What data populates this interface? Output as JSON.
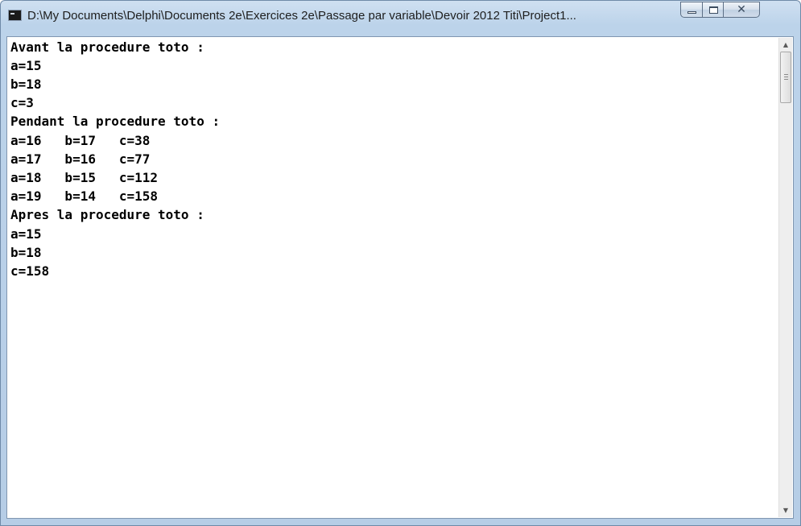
{
  "window": {
    "title": "D:\\My Documents\\Delphi\\Documents 2e\\Exercices 2e\\Passage par variable\\Devoir 2012 Titi\\Project1..."
  },
  "title_buttons": {
    "minimize_icon": "minimize-icon",
    "maximize_icon": "maximize-icon",
    "close_icon": "close-icon",
    "close_glyph": "✕"
  },
  "console": {
    "lines": [
      "Avant la procedure toto :",
      "a=15",
      "b=18",
      "c=3",
      "Pendant la procedure toto :",
      "a=16   b=17   c=38",
      "a=17   b=16   c=77",
      "a=18   b=15   c=112",
      "a=19   b=14   c=158",
      "Apres la procedure toto :",
      "a=15",
      "b=18",
      "c=158"
    ]
  },
  "scrollbar": {
    "up_arrow": "▲",
    "down_arrow": "▼"
  },
  "colors": {
    "frame": "#bcd3ea",
    "console_bg": "#ffffff",
    "text": "#000000"
  }
}
